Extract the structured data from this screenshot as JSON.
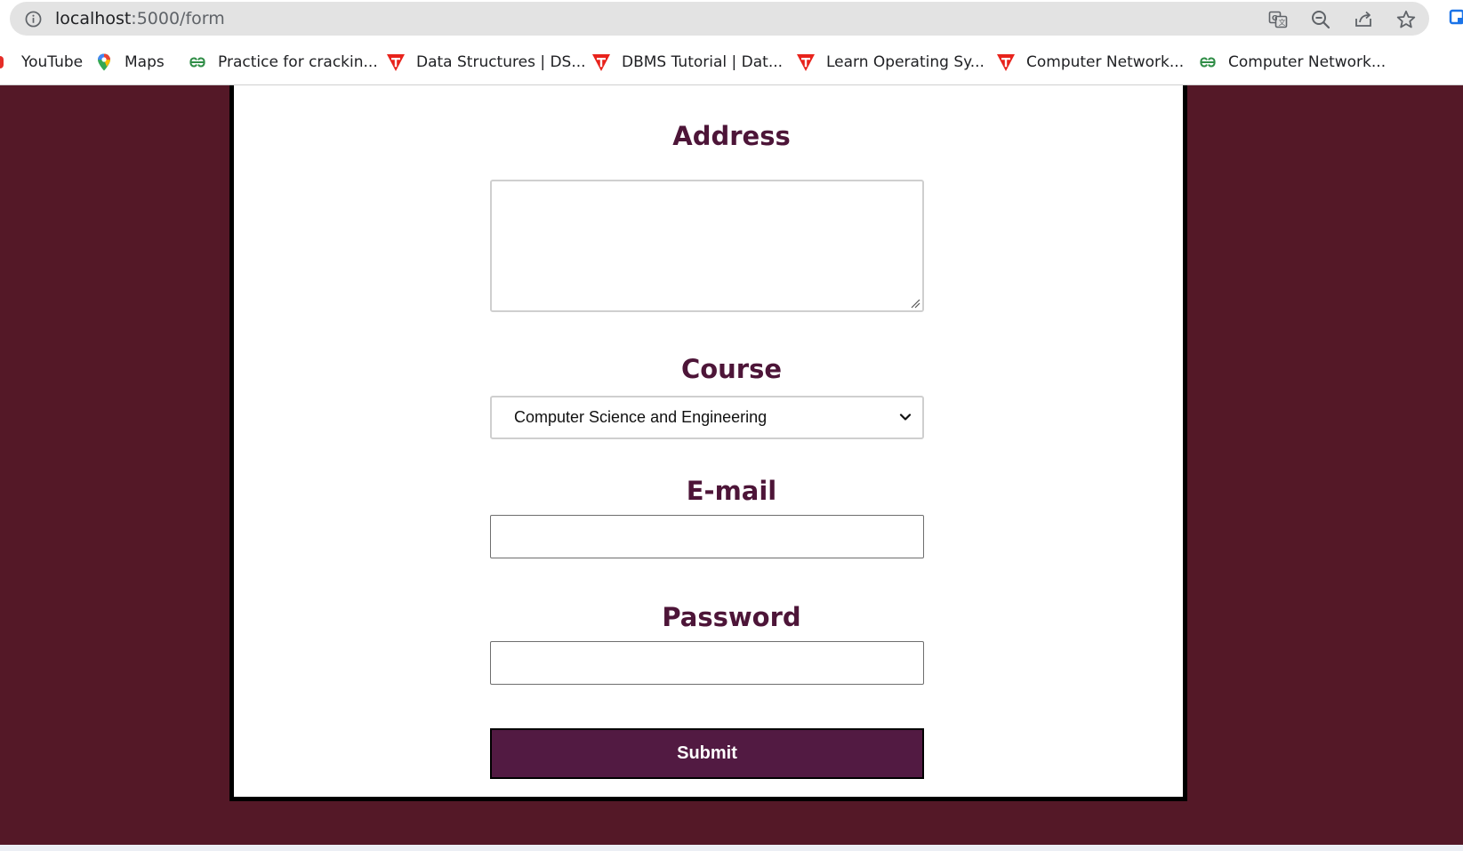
{
  "browser": {
    "url_host": "localhost",
    "url_path": ":5000/form",
    "bookmarks": [
      {
        "label": "YouTube",
        "icon": "youtube-icon"
      },
      {
        "label": "Maps",
        "icon": "maps-pin-icon"
      },
      {
        "label": "Practice for crackin...",
        "icon": "geeksforgeeks-icon"
      },
      {
        "label": "Data Structures | DS...",
        "icon": "tutorialspoint-icon"
      },
      {
        "label": "DBMS Tutorial | Dat...",
        "icon": "tutorialspoint-icon"
      },
      {
        "label": "Learn Operating Sy...",
        "icon": "tutorialspoint-icon"
      },
      {
        "label": "Computer Network...",
        "icon": "tutorialspoint-icon"
      },
      {
        "label": "Computer Network...",
        "icon": "geeksforgeeks-icon"
      }
    ],
    "toolbar_icons": [
      "translate-icon",
      "zoom-out-icon",
      "share-icon",
      "bookmark-star-icon"
    ]
  },
  "form": {
    "address_label": "Address",
    "address_value": "",
    "course_label": "Course",
    "course_selected": "Computer Science and Engineering",
    "email_label": "E-mail",
    "email_value": "",
    "password_label": "Password",
    "password_value": "",
    "submit_label": "Submit"
  },
  "colors": {
    "page_background": "#541827",
    "label_color": "#4d1538",
    "submit_background": "#521a42"
  }
}
